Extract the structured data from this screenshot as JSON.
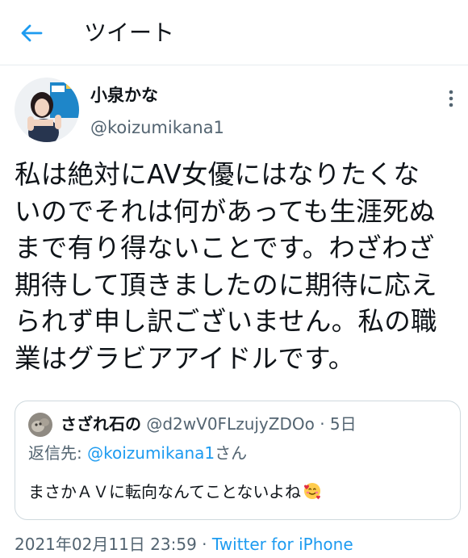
{
  "header": {
    "title": "ツイート",
    "back_icon": "arrow-left-icon",
    "accent": "#1d9bf0"
  },
  "author": {
    "name": "小泉かな",
    "handle": "@koizumikana1"
  },
  "tweet": {
    "lines": [
      "私は絶対にAV女優にはなりたくな",
      "いのでそれは何があっても生涯死ぬ",
      "まで有り得ないことです。わざわざ",
      "期待して頂きましたのに期待に応え",
      "られず申し訳ございません。私の職",
      "業はグラビアアイドルです。"
    ]
  },
  "quote": {
    "name": "さざれ石の",
    "handle": "@d2wV0FLzujyZDOo",
    "separator": "·",
    "time": "5日",
    "reply_prefix": "返信先: ",
    "reply_mention": "@koizumikana1",
    "reply_suffix": "さん",
    "text": "まさかＡＶに転向なんてことないよね",
    "emoji": "smiling-face-with-hearts-icon"
  },
  "footer": {
    "datetime": "2021年02月11日 23:59",
    "separator": " · ",
    "source": "Twitter for iPhone"
  }
}
